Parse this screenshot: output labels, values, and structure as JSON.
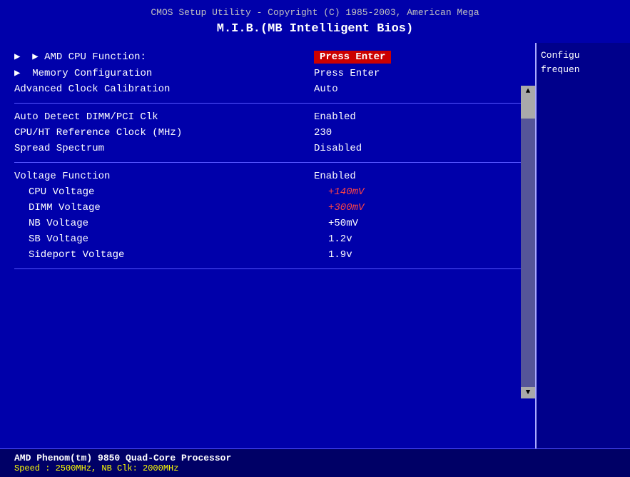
{
  "header": {
    "top_text": "CMOS Setup Utility - Copyright (C) 1985-2003, American Mega",
    "mib_title": "M.I.B.(MB Intelligent Bios)"
  },
  "menu": {
    "items": [
      {
        "id": "amd-cpu-function",
        "label": "▶ AMD CPU Function:",
        "value": "Press Enter",
        "highlighted": true,
        "indent": false
      },
      {
        "id": "memory-configuration",
        "label": "▶ Memory Configuration",
        "value": "Press Enter",
        "highlighted": false,
        "indent": false
      },
      {
        "id": "advanced-clock-calibration",
        "label": "Advanced Clock Calibration",
        "value": "Auto",
        "highlighted": false,
        "indent": false
      }
    ],
    "section2": [
      {
        "id": "auto-detect-dimm",
        "label": "Auto Detect DIMM/PCI Clk",
        "value": "Enabled",
        "highlighted": false,
        "indent": false
      },
      {
        "id": "cpu-ht-reference",
        "label": "CPU/HT Reference Clock (MHz)",
        "value": "230",
        "highlighted": false,
        "indent": false
      },
      {
        "id": "spread-spectrum",
        "label": "Spread Spectrum",
        "value": "Disabled",
        "highlighted": false,
        "indent": false
      }
    ],
    "section3": [
      {
        "id": "voltage-function",
        "label": "Voltage Function",
        "value": "Enabled",
        "highlighted": false,
        "indent": false
      },
      {
        "id": "cpu-voltage",
        "label": "CPU  Voltage",
        "value": "+140mV",
        "highlighted": false,
        "red": true,
        "indent": true
      },
      {
        "id": "dimm-voltage",
        "label": "DIMM Voltage",
        "value": "+300mV",
        "highlighted": false,
        "red": true,
        "indent": true
      },
      {
        "id": "nb-voltage",
        "label": "NB   Voltage",
        "value": "+50mV",
        "highlighted": false,
        "red": false,
        "indent": true
      },
      {
        "id": "sb-voltage",
        "label": "SB   Voltage",
        "value": "1.2v",
        "highlighted": false,
        "red": false,
        "indent": true
      },
      {
        "id": "sideport-voltage",
        "label": "Sideport Voltage",
        "value": "1.9v",
        "highlighted": false,
        "red": false,
        "indent": true
      }
    ]
  },
  "bottom": {
    "line1": "AMD Phenom(tm) 9850 Quad-Core Processor",
    "line2": "Speed  :  2500MHz,   NB Clk: 2000MHz"
  },
  "sidebar": {
    "text1": "Configu",
    "text2": "frequen"
  },
  "scrollbar": {
    "arrow_up": "▲",
    "arrow_down": "▼"
  }
}
